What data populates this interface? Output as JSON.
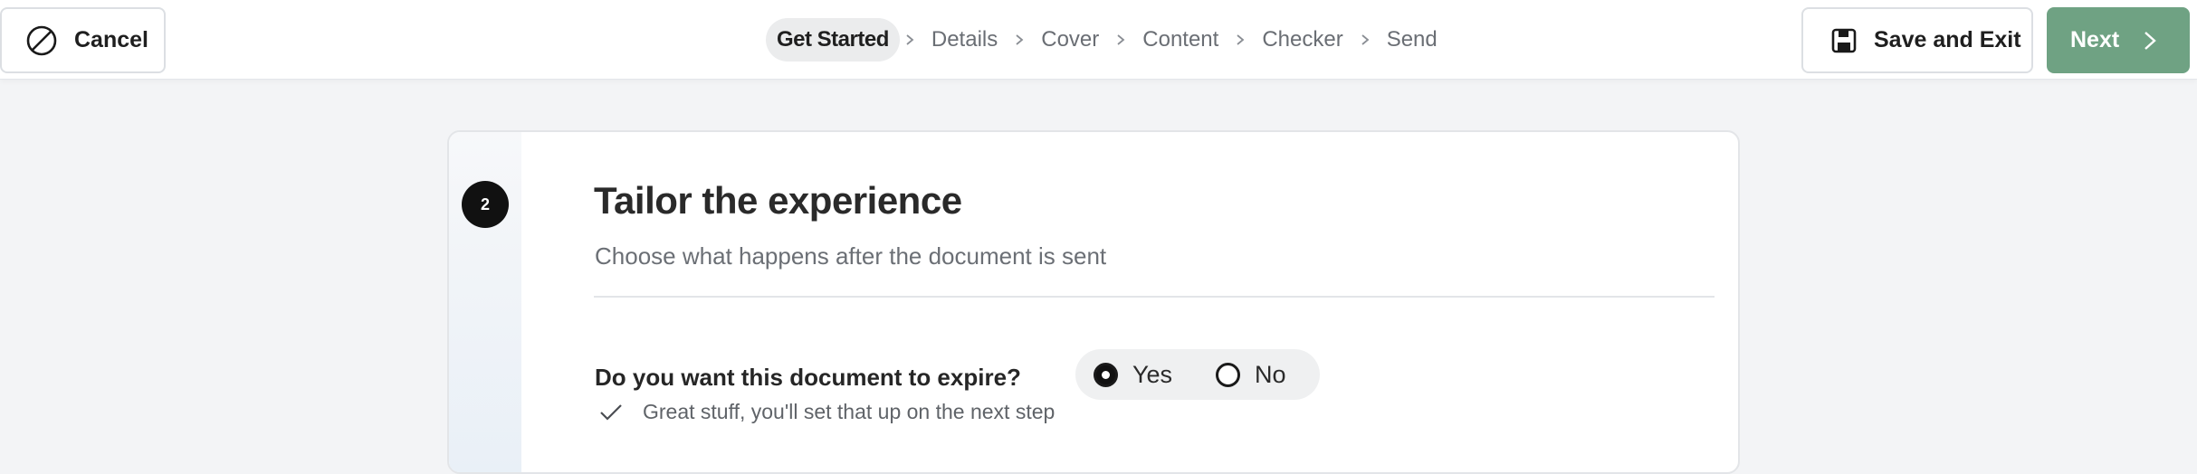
{
  "header": {
    "cancel_label": "Cancel",
    "steps": [
      {
        "label": "Get Started",
        "active": true
      },
      {
        "label": "Details",
        "active": false
      },
      {
        "label": "Cover",
        "active": false
      },
      {
        "label": "Content",
        "active": false
      },
      {
        "label": "Checker",
        "active": false
      },
      {
        "label": "Send",
        "active": false
      }
    ],
    "save_label": "Save and Exit",
    "next_label": "Next"
  },
  "card": {
    "step_number": "2",
    "title": "Tailor the experience",
    "subtitle": "Choose what happens after the document is sent",
    "question": "Do you want this document to expire?",
    "options": [
      {
        "label": "Yes",
        "selected": true
      },
      {
        "label": "No",
        "selected": false
      }
    ],
    "hint": "Great stuff, you'll set that up on the next step"
  },
  "colors": {
    "accent": "#6fa283",
    "badge": "#111111",
    "background": "#f3f4f6"
  },
  "icons": {
    "cancel": "prohibited-circle-icon",
    "save": "floppy-disk-icon",
    "next": "chevron-right-icon",
    "separator": "chevron-right-icon",
    "hint": "checkmark-icon"
  }
}
